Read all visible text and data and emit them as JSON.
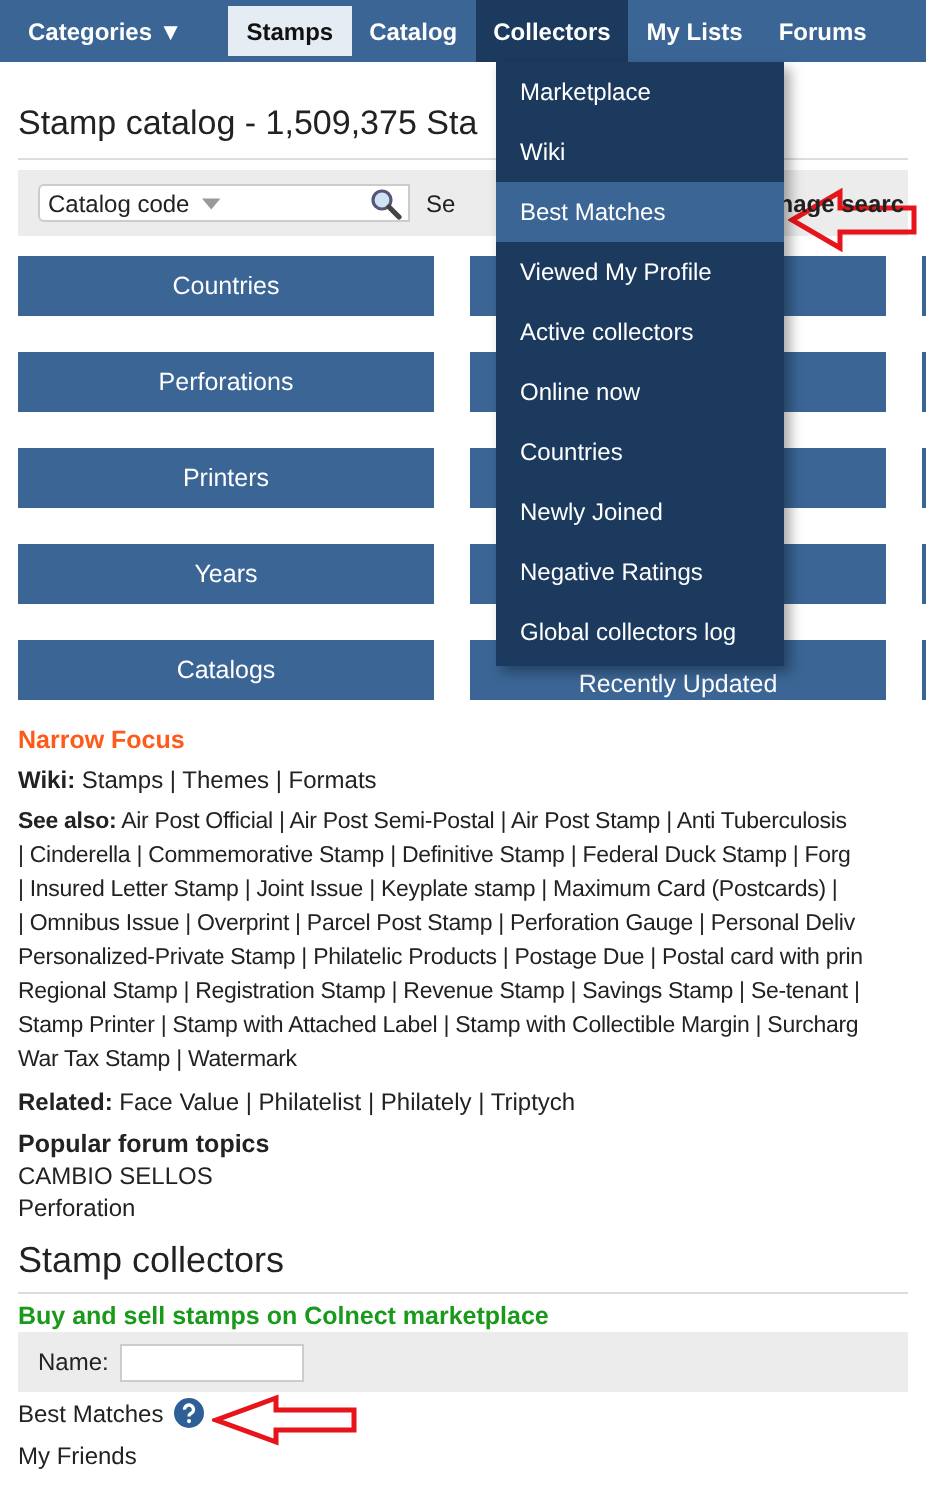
{
  "nav": {
    "items": [
      {
        "label": "Categories ▼",
        "selected": false,
        "open": false
      },
      {
        "label": "Stamps",
        "selected": true,
        "open": false
      },
      {
        "label": "Catalog",
        "selected": false,
        "open": false
      },
      {
        "label": "Collectors",
        "selected": false,
        "open": true
      },
      {
        "label": "My Lists",
        "selected": false,
        "open": false
      },
      {
        "label": "Forums",
        "selected": false,
        "open": false
      }
    ]
  },
  "dropdown": {
    "items": [
      {
        "label": "Marketplace",
        "selected": false
      },
      {
        "label": "Wiki",
        "selected": false
      },
      {
        "label": "Best Matches",
        "selected": true
      },
      {
        "label": "Viewed My Profile",
        "selected": false
      },
      {
        "label": "Active collectors",
        "selected": false
      },
      {
        "label": "Online now",
        "selected": false
      },
      {
        "label": "Countries",
        "selected": false
      },
      {
        "label": "Newly Joined",
        "selected": false
      },
      {
        "label": "Negative Ratings",
        "selected": false
      },
      {
        "label": "Global collectors log",
        "selected": false
      }
    ]
  },
  "page_title": "Stamp catalog - 1,509,375 Sta",
  "search": {
    "select": "Catalog code",
    "label_start": "Se",
    "image_search": "nage searc"
  },
  "buttons": [
    {
      "left": "Countries"
    },
    {
      "left": "Perforations"
    },
    {
      "left": "Printers"
    },
    {
      "left": "Years"
    },
    {
      "left": "Catalogs",
      "right": "Recently Updated"
    }
  ],
  "narrow_focus": {
    "title": "Narrow Focus",
    "wiki": "**Wiki:** Stamps | Themes | Formats",
    "see_also": [
      "**See also:** Air Post Official | Air Post Semi-Postal | Air Post Stamp | Anti Tuberculosis",
      "| Cinderella | Commemorative Stamp | Definitive Stamp | Federal Duck Stamp | Forg",
      "| Insured Letter Stamp | Joint Issue | Keyplate stamp | Maximum Card (Postcards) |",
      "| Omnibus Issue | Overprint | Parcel Post Stamp | Perforation Gauge | Personal Deliv",
      "Personalized-Private Stamp | Philatelic Products | Postage Due | Postal card with prin",
      "Regional Stamp | Registration Stamp | Revenue Stamp | Savings Stamp | Se-tenant |",
      "Stamp Printer | Stamp with Attached Label | Stamp with Collectible Margin | Surcharg",
      "War Tax Stamp | Watermark"
    ],
    "related": "**Related:** Face Value | Philatelist | Philately | Triptych",
    "forum": {
      "title": "Popular forum topics",
      "topics": [
        "CAMBIO SELLOS",
        "Perforation"
      ]
    }
  },
  "collectors": {
    "title": "Stamp collectors",
    "marketplace_link": "Buy and sell stamps on Colnect marketplace",
    "name_label": "Name:",
    "links": [
      "Best Matches",
      "My Friends"
    ]
  }
}
